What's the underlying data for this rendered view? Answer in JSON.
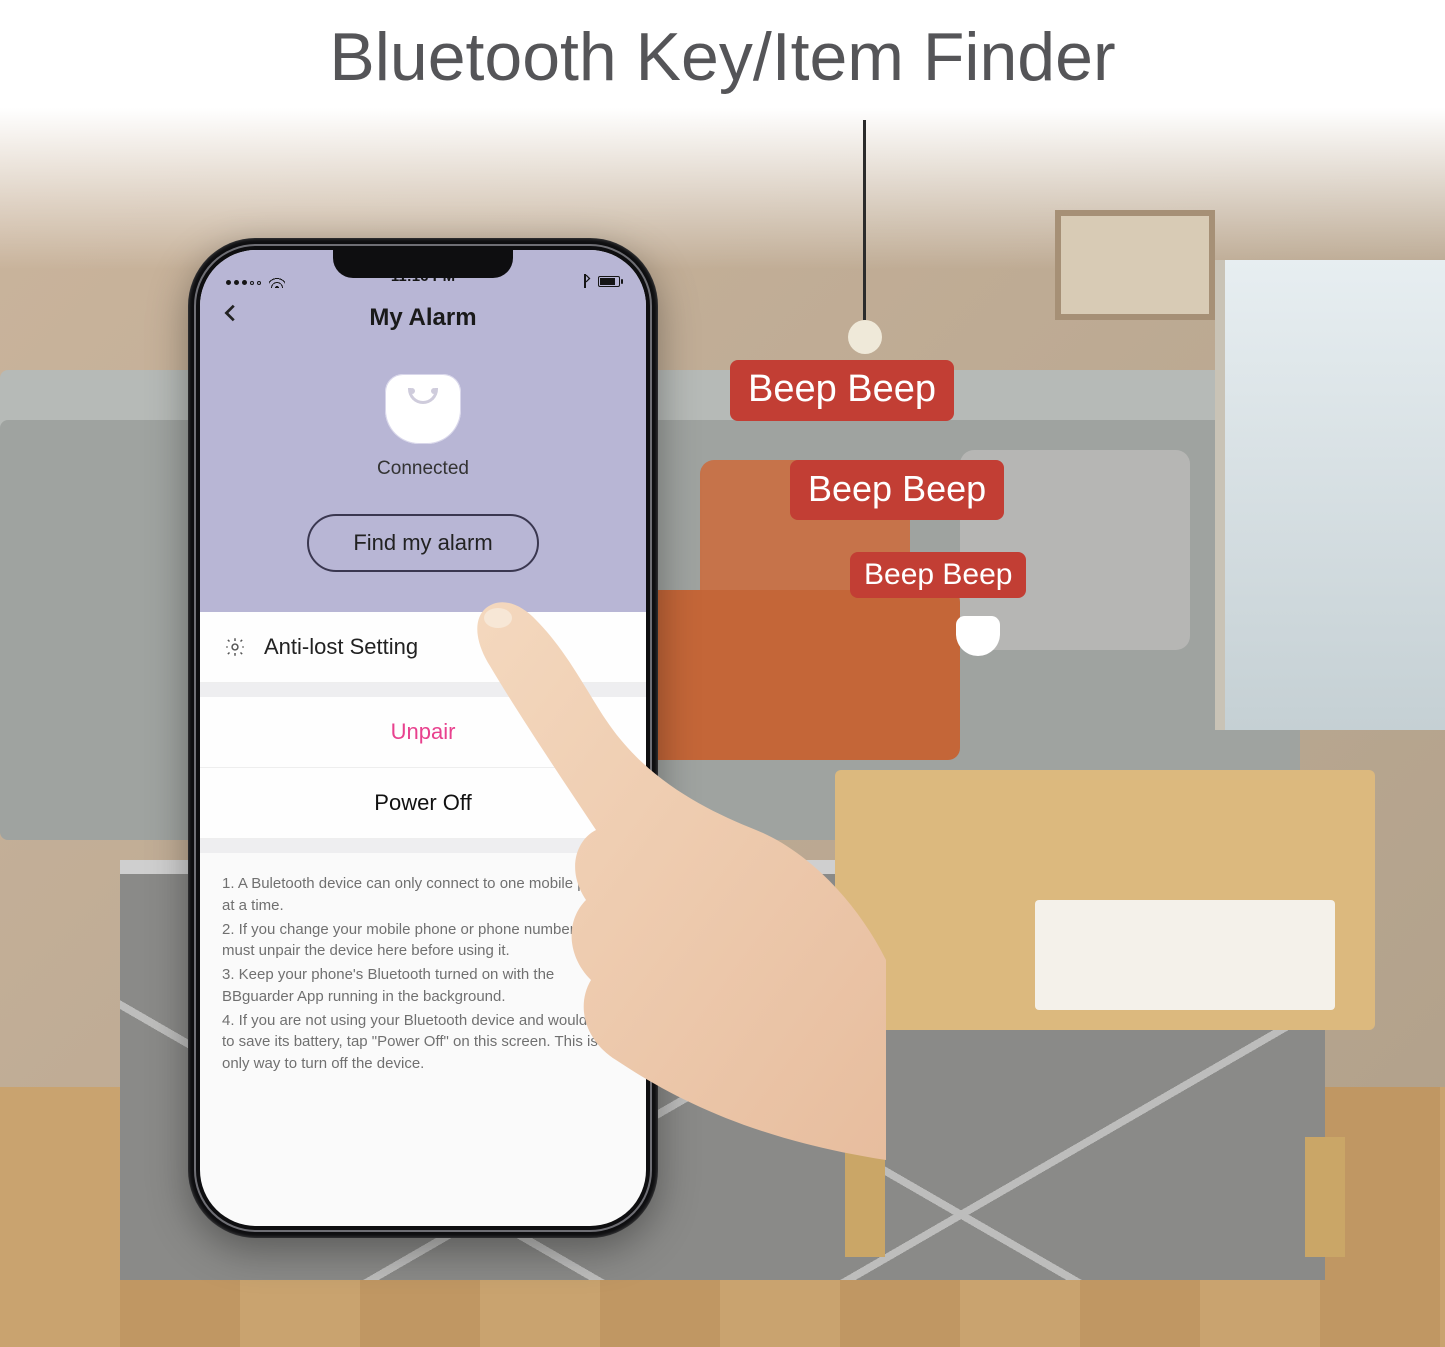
{
  "page_title": "Bluetooth Key/Item Finder",
  "beeps": [
    "Beep Beep",
    "Beep Beep",
    "Beep Beep"
  ],
  "phone": {
    "status": {
      "time": "11:16 PM"
    },
    "header": {
      "title": "My Alarm"
    },
    "hero": {
      "status_label": "Connected",
      "find_button": "Find my alarm"
    },
    "rows": {
      "anti_lost": "Anti-lost Setting",
      "unpair": "Unpair",
      "power_off": "Power Off"
    },
    "notes": {
      "n1": "1. A Buletooth device can only connect to one mobile phone at a time.",
      "n2": "2. If you change your mobile phone or phone number, you must unpair the device here before using it.",
      "n3": "3. Keep your phone's Bluetooth turned on with the BBguarder App running in the background.",
      "n4": "4. If you are not using your Bluetooth device and would like to save its battery, tap \"Power Off\" on this screen. This is the only way to turn off the device."
    }
  }
}
